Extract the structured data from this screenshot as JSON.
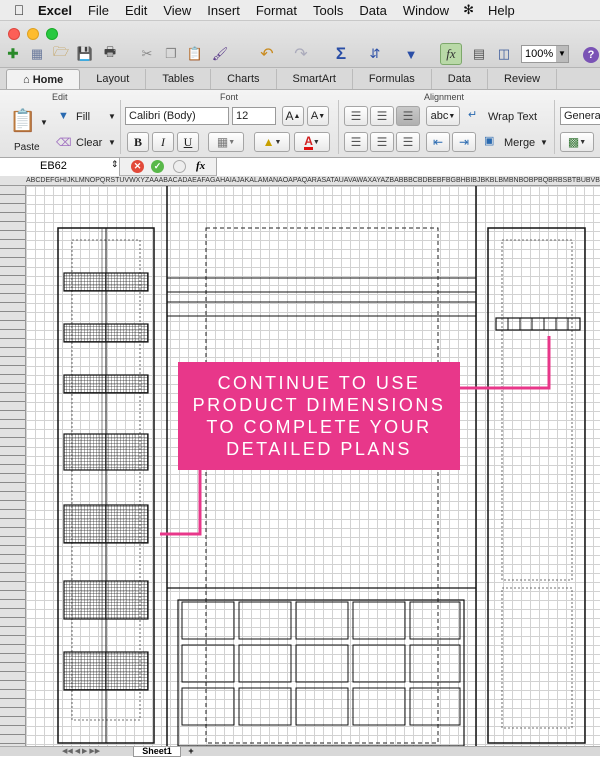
{
  "menubar": {
    "app": "Excel",
    "items": [
      "File",
      "Edit",
      "View",
      "Insert",
      "Format",
      "Tools",
      "Data",
      "Window",
      "Help"
    ]
  },
  "toolbar": {
    "zoom": "100%"
  },
  "tabs": [
    "Home",
    "Layout",
    "Tables",
    "Charts",
    "SmartArt",
    "Formulas",
    "Data",
    "Review"
  ],
  "ribbon": {
    "groups": {
      "edit": "Edit",
      "font": "Font",
      "alignment": "Alignment"
    },
    "paste_label": "Paste",
    "fill_label": "Fill",
    "clear_label": "Clear",
    "font_name": "Calibri (Body)",
    "font_size": "12",
    "bold": "B",
    "italic": "I",
    "underline": "U",
    "wrap_text": "Wrap Text",
    "merge": "Merge",
    "number_format": "General",
    "abc": "abc",
    "grow_font": "A",
    "shrink_font": "A"
  },
  "formula_bar": {
    "name_box": "EB62",
    "fx": "fx"
  },
  "sheet": {
    "column_letters": "ABCDEFGHIJKLMNOPQRSTUVWXYZAAABACADAEAFAGAHAIAJAKALAMANAOAPAQARASATAUAVAWAXAYAZBABBBCBDBEBFBGBHBIBJBKBLBMBNBOBPBQBRBSBTBUBVBWBXBYBZCACBCCCDCECF"
  },
  "callout": {
    "lines": [
      "CONTINUE TO USE",
      "PRODUCT DIMENSIONS",
      "TO COMPLETE YOUR",
      "DETAILED PLANS"
    ],
    "color": "#e8378a"
  },
  "sheet_tabs": {
    "tab1": "Sheet1",
    "add": "+"
  }
}
